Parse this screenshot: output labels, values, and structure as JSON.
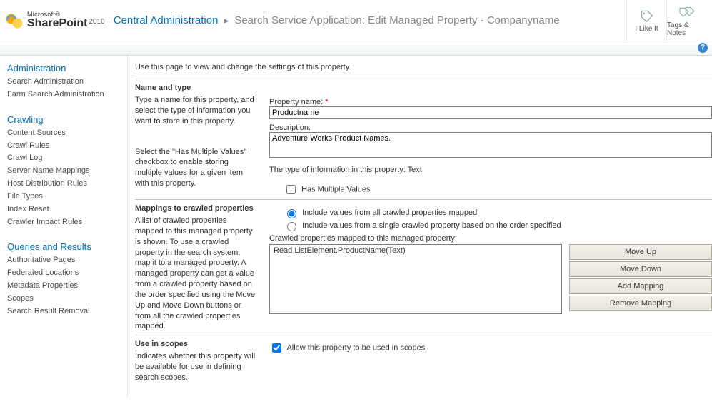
{
  "header": {
    "product_ms": "Microsoft®",
    "product_name": "SharePoint",
    "product_year": "2010",
    "breadcrumb_root": "Central Administration",
    "breadcrumb_page": "Search Service Application: Edit Managed Property - Companyname",
    "like_label": "I Like It",
    "tags_label": "Tags & Notes"
  },
  "leftnav": {
    "sections": [
      {
        "title": "Administration",
        "links": [
          "Search Administration",
          "Farm Search Administration"
        ]
      },
      {
        "title": "Crawling",
        "links": [
          "Content Sources",
          "Crawl Rules",
          "Crawl Log",
          "Server Name Mappings",
          "Host Distribution Rules",
          "File Types",
          "Index Reset",
          "Crawler Impact Rules"
        ]
      },
      {
        "title": "Queries and Results",
        "links": [
          "Authoritative Pages",
          "Federated Locations",
          "Metadata Properties",
          "Scopes",
          "Search Result Removal"
        ]
      }
    ]
  },
  "page": {
    "description": "Use this page to view and change the settings of this property."
  },
  "name_type": {
    "heading": "Name and type",
    "desc1": "Type a name for this property, and select the type of information you want to store in this property.",
    "desc2": "Select the \"Has Multiple Values\" checkbox to enable storing multiple values for a given item with this property.",
    "property_name_label": "Property name:",
    "property_name_value": "Productname",
    "description_label": "Description:",
    "description_value": "Adventure Works Product Names.",
    "type_line": "The type of information in this property: Text",
    "has_multiple_label": "Has Multiple Values",
    "has_multiple_checked": false
  },
  "mappings": {
    "heading": "Mappings to crawled properties",
    "desc": "A list of crawled properties mapped to this managed property is shown. To use a crawled property in the search system, map it to a managed property. A managed property can get a value from a crawled property based on the order specified using the Move Up and Move Down buttons or from all the crawled properties mapped.",
    "radio_all": "Include values from all crawled properties mapped",
    "radio_single": "Include values from a single crawled property based on the order specified",
    "radio_selected": "all",
    "list_label": "Crawled properties mapped to this managed property:",
    "items": [
      "Read ListElement.ProductName(Text)"
    ],
    "buttons": {
      "up": "Move Up",
      "down": "Move Down",
      "add": "Add Mapping",
      "remove": "Remove Mapping"
    }
  },
  "scopes": {
    "heading": "Use in scopes",
    "desc": "Indicates whether this property will be available for use in defining search scopes.",
    "allow_label": "Allow this property to be used in scopes",
    "allow_checked": true
  }
}
